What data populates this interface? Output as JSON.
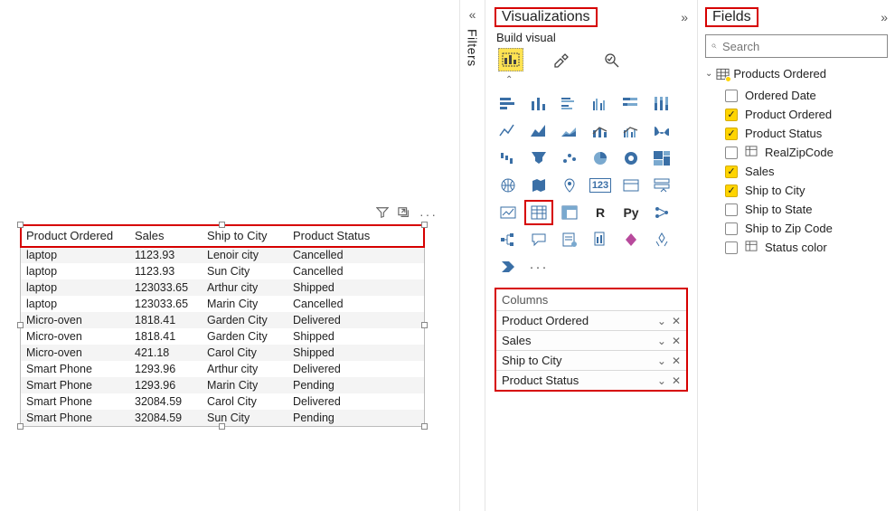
{
  "filters_label": "Filters",
  "viz": {
    "title": "Visualizations",
    "build_label": "Build visual",
    "wells_title": "Columns",
    "wells": [
      {
        "label": "Product Ordered"
      },
      {
        "label": "Sales"
      },
      {
        "label": "Ship to City"
      },
      {
        "label": "Product Status"
      }
    ]
  },
  "fields": {
    "title": "Fields",
    "search_placeholder": "Search",
    "table_name": "Products Ordered",
    "items": [
      {
        "label": "Ordered Date",
        "checked": false,
        "measure": false
      },
      {
        "label": "Product Ordered",
        "checked": true,
        "measure": false
      },
      {
        "label": "Product Status",
        "checked": true,
        "measure": false
      },
      {
        "label": "RealZipCode",
        "checked": false,
        "measure": true
      },
      {
        "label": "Sales",
        "checked": true,
        "measure": false
      },
      {
        "label": "Ship to City",
        "checked": true,
        "measure": false
      },
      {
        "label": "Ship to State",
        "checked": false,
        "measure": false
      },
      {
        "label": "Ship to Zip Code",
        "checked": false,
        "measure": false
      },
      {
        "label": "Status color",
        "checked": false,
        "measure": true
      }
    ]
  },
  "table": {
    "headers": [
      "Product Ordered",
      "Sales",
      "Ship to City",
      "Product Status"
    ],
    "rows": [
      [
        "laptop",
        "1123.93",
        "Lenoir city",
        "Cancelled"
      ],
      [
        "laptop",
        "1123.93",
        "Sun City",
        "Cancelled"
      ],
      [
        "laptop",
        "123033.65",
        "Arthur city",
        "Shipped"
      ],
      [
        "laptop",
        "123033.65",
        "Marin City",
        "Cancelled"
      ],
      [
        "Micro-oven",
        "1818.41",
        "Garden City",
        "Delivered"
      ],
      [
        "Micro-oven",
        "1818.41",
        "Garden City",
        "Shipped"
      ],
      [
        "Micro-oven",
        "421.18",
        "Carol City",
        "Shipped"
      ],
      [
        "Smart Phone",
        "1293.96",
        "Arthur city",
        "Delivered"
      ],
      [
        "Smart Phone",
        "1293.96",
        "Marin City",
        "Pending"
      ],
      [
        "Smart Phone",
        "32084.59",
        "Carol City",
        "Delivered"
      ],
      [
        "Smart Phone",
        "32084.59",
        "Sun City",
        "Pending"
      ]
    ]
  }
}
